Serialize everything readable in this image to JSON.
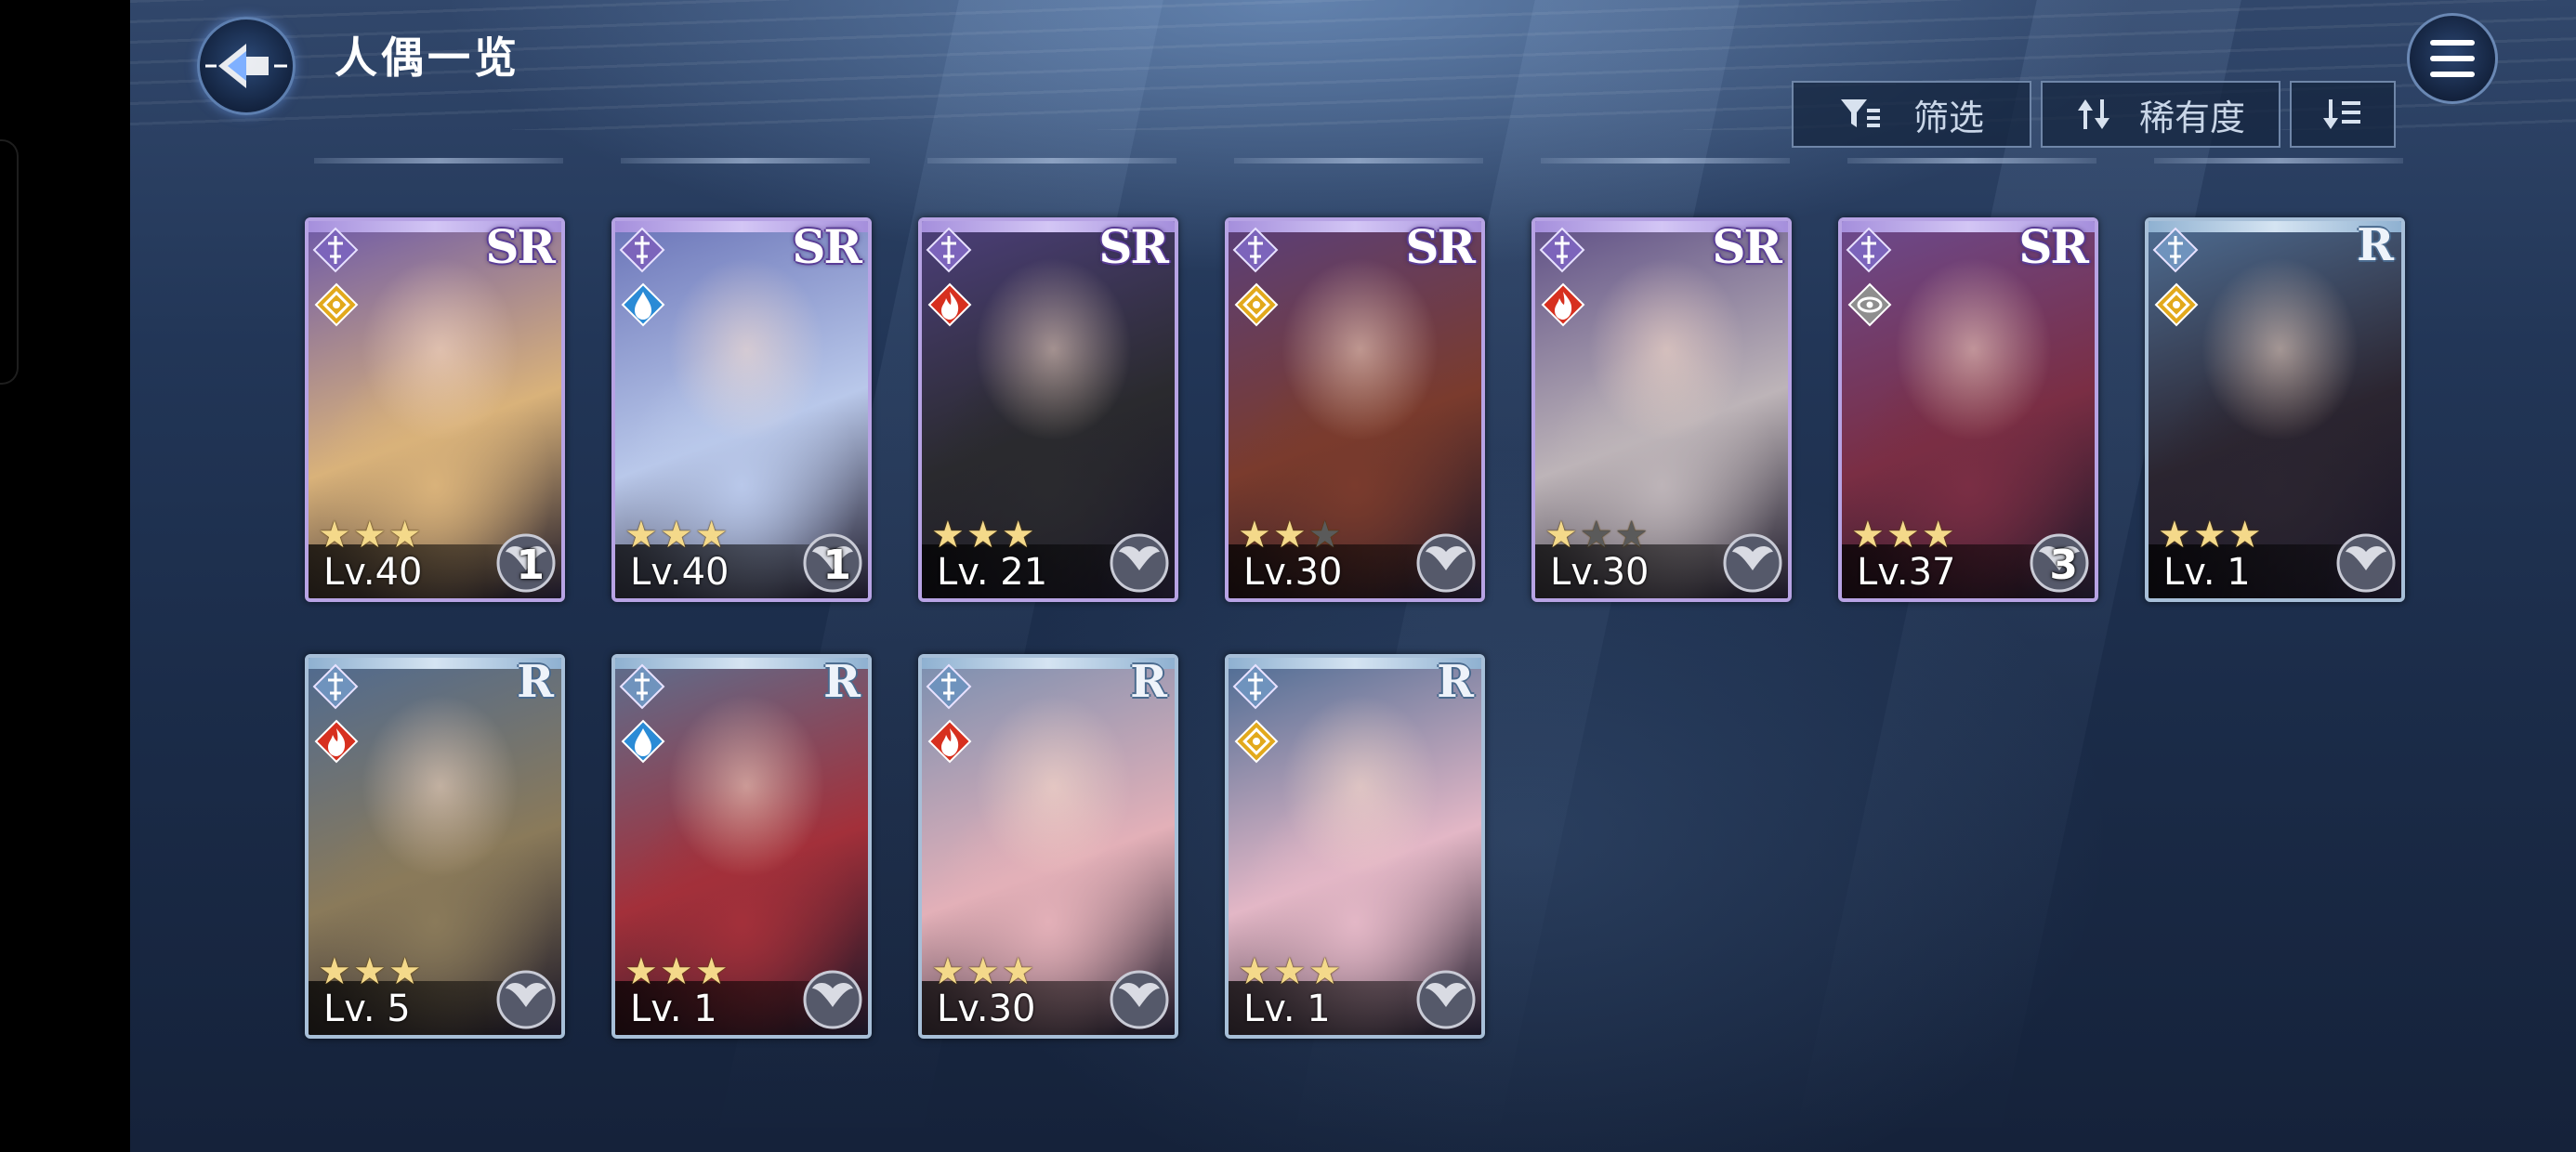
{
  "header": {
    "title": "人偶一览"
  },
  "toolbar": {
    "filter_label": "筛选",
    "sort_label": "稀有度"
  },
  "cards": [
    {
      "rarity": "SR",
      "stars": 3,
      "level": "Lv.40",
      "bond": "1",
      "element": "light",
      "weapon_class": "sword",
      "palette": [
        "#6e5aa8",
        "#d9b27a"
      ]
    },
    {
      "rarity": "SR",
      "stars": 3,
      "level": "Lv.40",
      "bond": "1",
      "element": "water",
      "weapon_class": "sword",
      "palette": [
        "#6a74b8",
        "#b9c8ea"
      ]
    },
    {
      "rarity": "SR",
      "stars": 3,
      "level": "Lv. 21",
      "bond": "",
      "element": "fire",
      "weapon_class": "staff",
      "palette": [
        "#4c3f7a",
        "#2a2a2e"
      ]
    },
    {
      "rarity": "SR",
      "stars": 2,
      "level": "Lv.30",
      "bond": "",
      "element": "light",
      "weapon_class": "sword",
      "palette": [
        "#5a3f7a",
        "#7a3b2d"
      ]
    },
    {
      "rarity": "SR",
      "stars": 1,
      "level": "Lv.30",
      "bond": "",
      "element": "fire",
      "weapon_class": "shield",
      "palette": [
        "#5e4f86",
        "#bdb4b8"
      ]
    },
    {
      "rarity": "SR",
      "stars": 3,
      "level": "Lv.37",
      "bond": "3",
      "element": "dark",
      "weapon_class": "eye",
      "palette": [
        "#6b4a8e",
        "#7a2e44"
      ]
    },
    {
      "rarity": "R",
      "stars": 3,
      "level": "Lv. 1",
      "bond": "",
      "element": "light",
      "weapon_class": "sword",
      "palette": [
        "#4e6d93",
        "#2b2530"
      ]
    },
    {
      "rarity": "R",
      "stars": 3,
      "level": "Lv. 5",
      "bond": "",
      "element": "fire",
      "weapon_class": "sword",
      "palette": [
        "#4f6a90",
        "#8a7a5a"
      ]
    },
    {
      "rarity": "R",
      "stars": 3,
      "level": "Lv. 1",
      "bond": "",
      "element": "water",
      "weapon_class": "shield",
      "palette": [
        "#5c6e8e",
        "#a3303a"
      ]
    },
    {
      "rarity": "R",
      "stars": 3,
      "level": "Lv.30",
      "bond": "",
      "element": "fire",
      "weapon_class": "sword",
      "palette": [
        "#7a8fb0",
        "#e3b0b8"
      ]
    },
    {
      "rarity": "R",
      "stars": 3,
      "level": "Lv. 1",
      "bond": "",
      "element": "light",
      "weapon_class": "sword",
      "palette": [
        "#4d6c94",
        "#e3b7c6"
      ]
    }
  ],
  "colors": {
    "element_fire": "#d7301f",
    "element_water": "#2a8bd6",
    "element_light": "#e2a91c",
    "element_dark": "#8e8e8e",
    "sr_frame": "#b7a3e4",
    "r_frame": "#a7bfd8"
  },
  "icons": {
    "back": "back-arrow-icon",
    "menu": "hamburger-menu-icon",
    "filter": "filter-icon",
    "sort": "sort-arrows-icon",
    "order": "sort-order-icon"
  }
}
